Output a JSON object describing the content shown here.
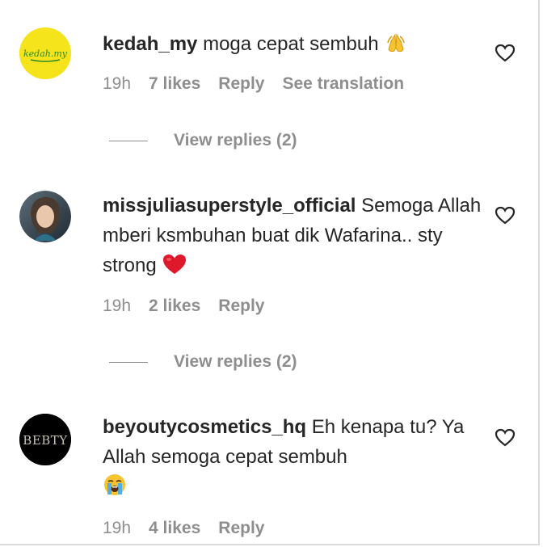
{
  "comments": [
    {
      "username": "kedah_my",
      "text": "moga cepat sembuh",
      "emoji": "folded-hands",
      "time": "19h",
      "likes": "7 likes",
      "reply": "Reply",
      "translate": "See translation",
      "view_replies": "View replies (2)",
      "avatar_text": "kedah.my",
      "avatar_color": "#f5e31c"
    },
    {
      "username": "missjuliasuperstyle_official",
      "text": "Semoga Allah mberi ksmbuhan buat dik Wafarina.. sty strong",
      "emoji": "red-heart",
      "time": "19h",
      "likes": "2 likes",
      "reply": "Reply",
      "view_replies": "View replies (2)"
    },
    {
      "username": "beyoutycosmetics_hq",
      "text": "Eh kenapa tu? Ya Allah semoga cepat sembuh",
      "emoji": "loudly-crying-face",
      "time": "19h",
      "likes": "4 likes",
      "reply": "Reply",
      "avatar_text": "BEBTY",
      "avatar_color": "#000000"
    }
  ]
}
